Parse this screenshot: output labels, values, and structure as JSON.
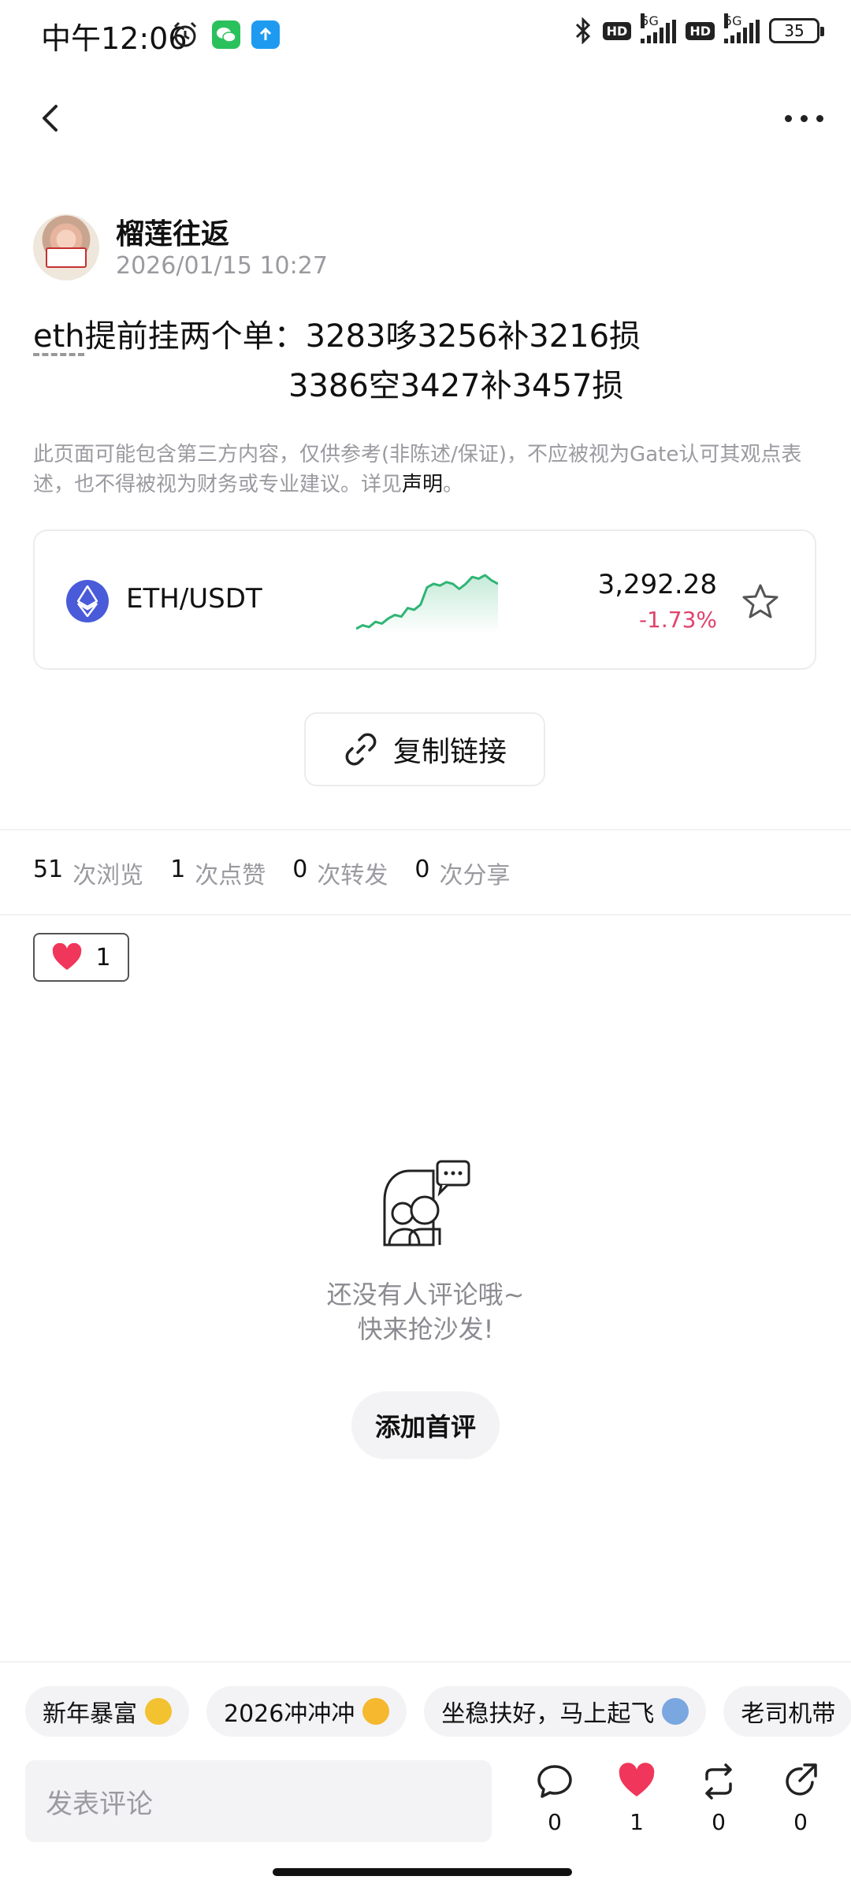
{
  "status_bar": {
    "time": "中午12:06",
    "network_1": "5G",
    "network_2": "5G",
    "hd_1": "HD",
    "hd_2": "HD",
    "battery": "35"
  },
  "author": {
    "name": "榴莲往返",
    "timestamp": "2026/01/15 10:27"
  },
  "post": {
    "tag": "eth",
    "line1_rest": "提前挂两个单：3283哆3256补3216损",
    "line2": "3386空3427补3457损"
  },
  "disclaimer": {
    "text": "此页面可能包含第三方内容，仅供参考(非陈述/保证)，不应被视为Gate认可其观点表述，也不得被视为财务或专业建议。详见",
    "link": "声明",
    "end": "。"
  },
  "market": {
    "pair": "ETH/USDT",
    "price": "3,292.28",
    "change": "-1.73%",
    "trend_color": "#2fb574",
    "down_color": "#e0436b",
    "sparkline": [
      10,
      12,
      11,
      14,
      13,
      16,
      18,
      17,
      22,
      21,
      24,
      34,
      36,
      35,
      37,
      36,
      33,
      36,
      40,
      39,
      41,
      38,
      36
    ]
  },
  "copy_link": {
    "label": "复制链接"
  },
  "stats": {
    "views_count": "51",
    "views_label": "次浏览",
    "likes_count": "1",
    "likes_label": "次点赞",
    "reposts_count": "0",
    "reposts_label": "次转发",
    "shares_count": "0",
    "shares_label": "次分享"
  },
  "reaction": {
    "count": "1"
  },
  "empty_comments": {
    "line1": "还没有人评论哦~",
    "line2": "快来抢沙发!",
    "button": "添加首评"
  },
  "quick_replies": [
    {
      "text": "新年暴富",
      "emoji_color": "#f2c230"
    },
    {
      "text": "2026冲冲冲",
      "emoji_color": "#f5b82e"
    },
    {
      "text": "坐稳扶好，马上起飞",
      "emoji_color": "#7aa7e0"
    },
    {
      "text": "老司机带",
      "emoji_color": "#cccccc"
    }
  ],
  "comment_input": {
    "placeholder": "发表评论"
  },
  "actions": {
    "comment_count": "0",
    "like_count": "1",
    "repost_count": "0",
    "share_count": "0"
  }
}
